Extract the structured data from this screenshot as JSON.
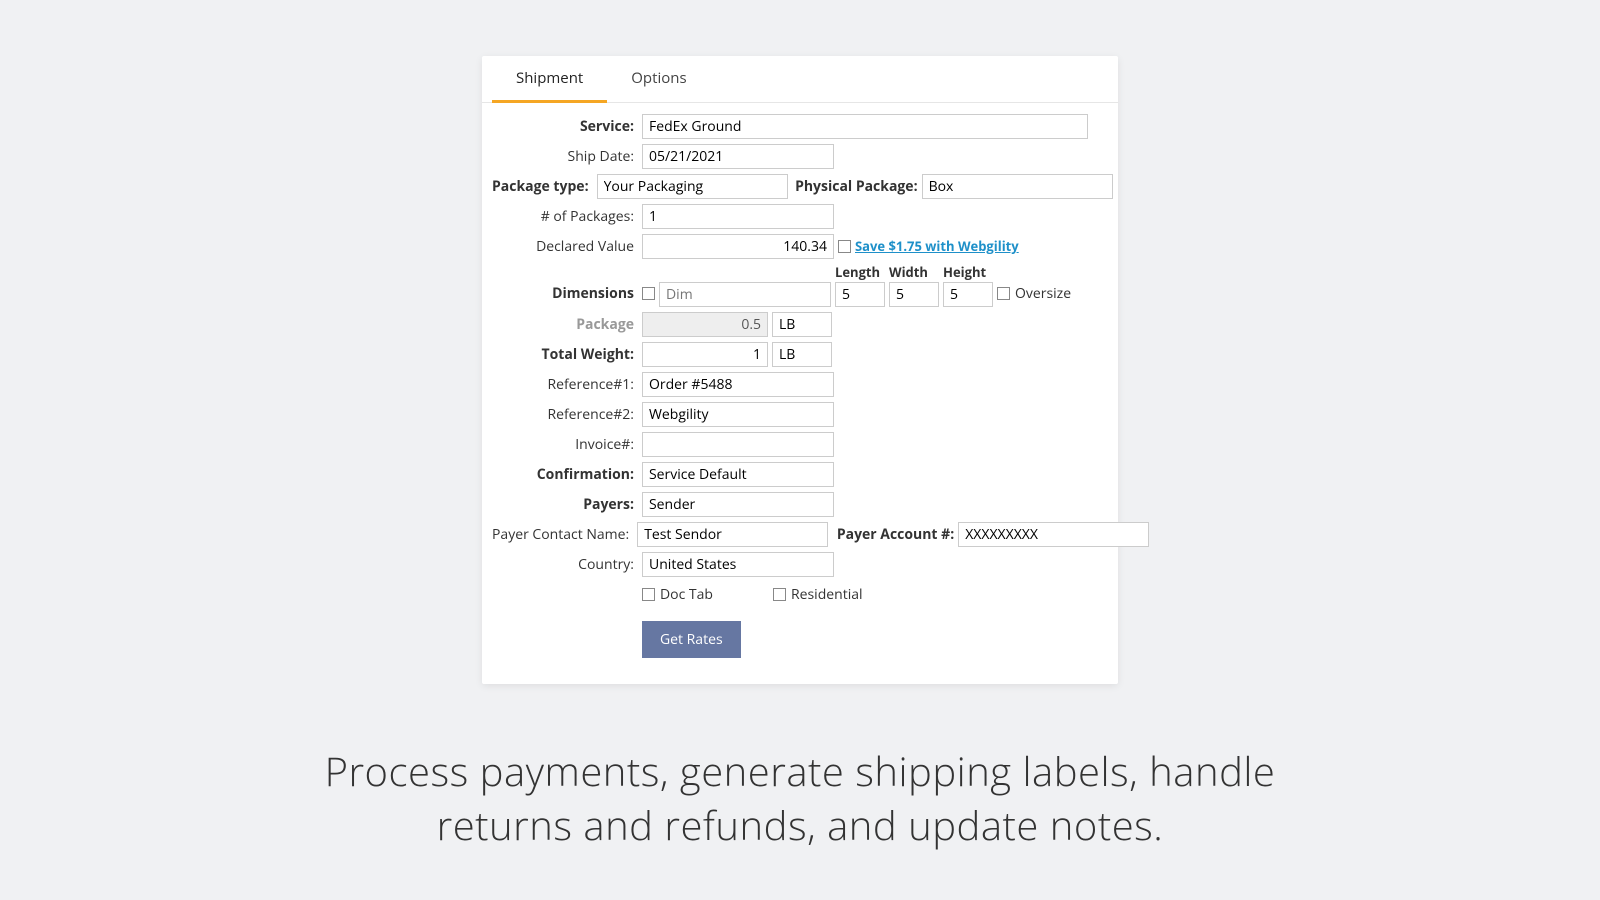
{
  "tabs": {
    "shipment": "Shipment",
    "options": "Options"
  },
  "labels": {
    "service": "Service:",
    "ship_date": "Ship Date:",
    "package_type": "Package type:",
    "physical_package": "Physical Package:",
    "num_packages": "# of Packages:",
    "declared_value": "Declared Value",
    "dimensions": "Dimensions",
    "length": "Length",
    "width": "Width",
    "height": "Height",
    "oversize": "Oversize",
    "package": "Package",
    "total_weight": "Total Weight:",
    "ref1": "Reference#1:",
    "ref2": "Reference#2:",
    "invoice": "Invoice#:",
    "confirmation": "Confirmation:",
    "payers": "Payers:",
    "payer_contact": "Payer Contact Name:",
    "payer_account": "Payer Account #:",
    "country": "Country:",
    "doc_tab": "Doc Tab",
    "residential": "Residential"
  },
  "values": {
    "service": "FedEx Ground",
    "ship_date": "05/21/2021",
    "package_type": "Your Packaging",
    "physical_package": "Box",
    "num_packages": "1",
    "declared_value": "140.34",
    "dim_placeholder": "Dim",
    "length": "5",
    "width": "5",
    "height": "5",
    "package_weight": "0.5",
    "total_weight": "1",
    "unit_lb": "LB",
    "ref1": "Order #5488",
    "ref2": "Webgility",
    "invoice": "",
    "confirmation": "Service Default",
    "payers": "Sender",
    "payer_contact": "Test Sendor",
    "payer_account": "XXXXXXXXX",
    "country": "United States"
  },
  "link_save": "Save $1.75 with Webgility",
  "btn_get_rates": "Get Rates",
  "caption": "Process payments, generate shipping labels, handle returns and refunds, and update notes."
}
